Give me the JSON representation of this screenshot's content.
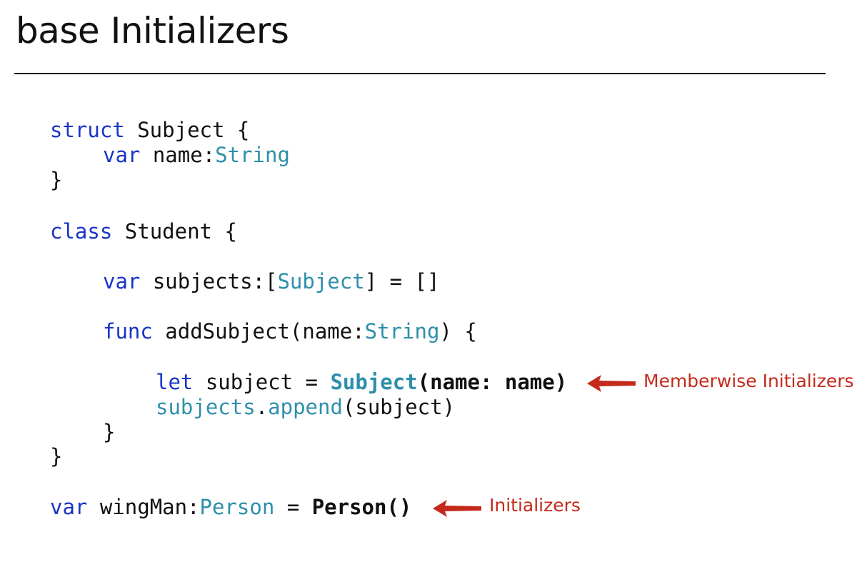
{
  "slide": {
    "title": "base Initializers"
  },
  "code": {
    "l1": {
      "kw": "struct",
      "rest": " Subject {"
    },
    "l2": {
      "kw": "var",
      "name": " name:",
      "type": "String"
    },
    "l3": {
      "text": "}"
    },
    "l4": {
      "kw": "class",
      "rest": " Student {"
    },
    "l5": {
      "kw": "var",
      "name": " subjects:[",
      "type": "Subject",
      "rest": "] = []"
    },
    "l6": {
      "kw": "func",
      "name": " addSubject(name:",
      "type": "String",
      "rest": ") {"
    },
    "l7": {
      "kw": "let",
      "name": " subject = ",
      "type": "Subject",
      "rest": "(name: name)"
    },
    "l8": {
      "obj": "subjects",
      "dot": ".",
      "method": "append",
      "rest": "(subject)"
    },
    "l9": {
      "text": "}"
    },
    "l10": {
      "text": "}"
    },
    "l11": {
      "kw": "var",
      "name": " wingMan:",
      "type": "Person",
      "eq": " = ",
      "call": "Person()"
    }
  },
  "annotations": {
    "memberwise": "Memberwise Initializers",
    "initializers": "Initializers"
  },
  "colors": {
    "keyword": "#1a34c8",
    "type": "#2e8fab",
    "annotation": "#c42a1c"
  }
}
